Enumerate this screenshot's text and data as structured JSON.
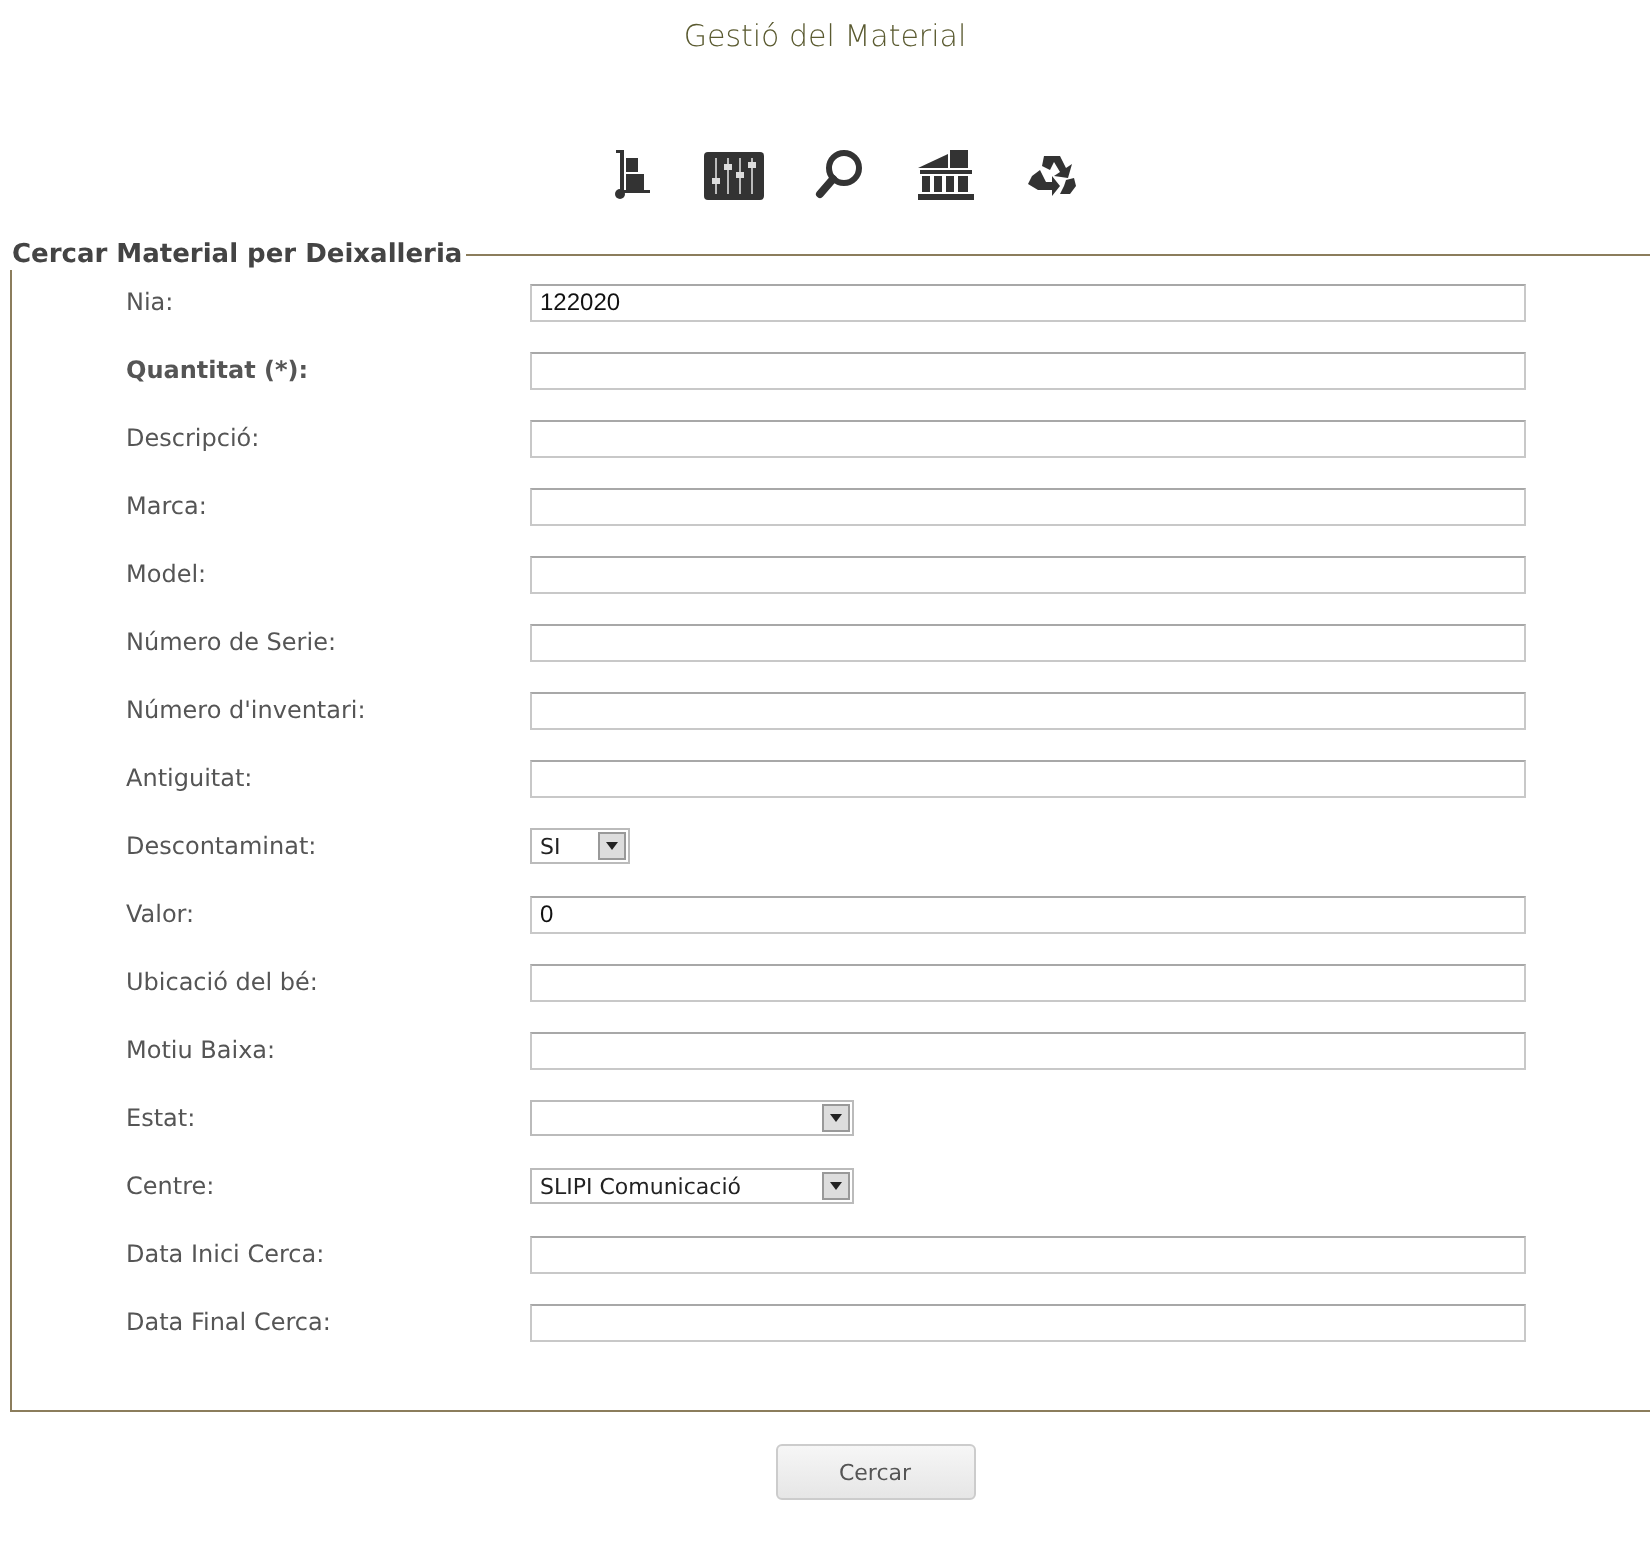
{
  "title": "Gestió del Material",
  "toolbar": [
    {
      "kind": "trolley"
    },
    {
      "kind": "sliders"
    },
    {
      "kind": "search"
    },
    {
      "kind": "building"
    },
    {
      "kind": "recycle"
    }
  ],
  "form": {
    "legend": "Cercar Material per Deixalleria",
    "fields": [
      {
        "label": "Nia:",
        "kind": "text",
        "required": false,
        "value": "122020"
      },
      {
        "label": "Quantitat (*):",
        "kind": "text",
        "required": true
      },
      {
        "label": "Descripció:",
        "kind": "text",
        "required": false
      },
      {
        "label": "Marca:",
        "kind": "text",
        "required": false
      },
      {
        "label": "Model:",
        "kind": "text",
        "required": false
      },
      {
        "label": "Número de Serie:",
        "kind": "text",
        "required": false
      },
      {
        "label": "Número d'inventari:",
        "kind": "text",
        "required": false
      },
      {
        "label": "Antiguitat:",
        "kind": "text",
        "required": false
      },
      {
        "label": "Descontaminat:",
        "kind": "choice",
        "required": false,
        "value": "SI"
      },
      {
        "label": "Valor:",
        "kind": "text",
        "required": false,
        "value": "0"
      },
      {
        "label": "Ubicació del bé:",
        "kind": "text",
        "required": false
      },
      {
        "label": "Motiu Baixa:",
        "kind": "text",
        "required": false
      },
      {
        "label": "Estat:",
        "kind": "select",
        "required": false
      },
      {
        "label": "Centre:",
        "kind": "select",
        "required": false,
        "value": "SLIPI Comunicació"
      },
      {
        "label": "Data Inici Cerca:",
        "kind": "text",
        "required": false
      },
      {
        "label": "Data Final Cerca:",
        "kind": "text",
        "required": false
      }
    ]
  },
  "submit": "Cercar"
}
